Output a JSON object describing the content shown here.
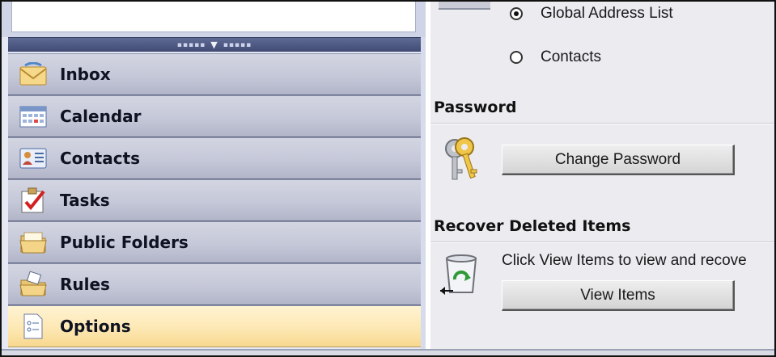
{
  "navigation": {
    "items": [
      {
        "label": "Inbox",
        "icon": "inbox-icon"
      },
      {
        "label": "Calendar",
        "icon": "calendar-icon"
      },
      {
        "label": "Contacts",
        "icon": "contacts-icon"
      },
      {
        "label": "Tasks",
        "icon": "tasks-icon"
      },
      {
        "label": "Public Folders",
        "icon": "public-folders-icon"
      },
      {
        "label": "Rules",
        "icon": "rules-icon"
      },
      {
        "label": "Options",
        "icon": "options-icon",
        "selected": true
      }
    ]
  },
  "address_options": {
    "radio_global": "Global Address List",
    "radio_contacts": "Contacts",
    "selected": "Global Address List"
  },
  "password_section": {
    "title": "Password",
    "button_label": "Change Password"
  },
  "recover_section": {
    "title": "Recover Deleted Items",
    "description": "Click View Items to view and recove",
    "button_label": "View Items"
  },
  "colors": {
    "selected_nav": "#fde8b4",
    "nav_item": "#c5c8d8",
    "grip_bar": "#4a5580",
    "pane_background": "#ecebf0"
  }
}
